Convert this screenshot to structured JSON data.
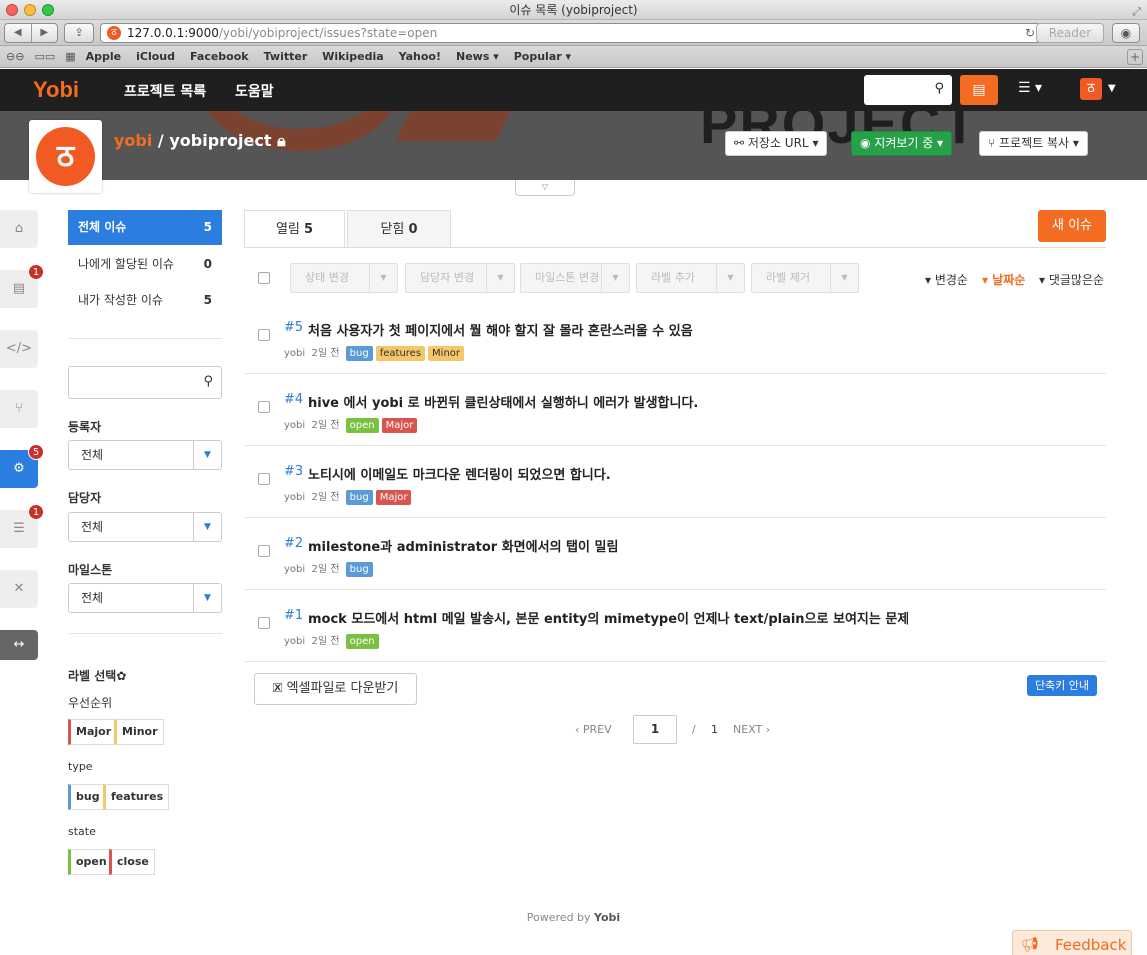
{
  "window": {
    "title": "이슈 목록 (yobiproject)"
  },
  "browser": {
    "url_host": "127.0.0.1:9000",
    "url_path": "/yobi/yobiproject/issues?state=open",
    "reader_label": "Reader",
    "bookmarks": [
      "Apple",
      "iCloud",
      "Facebook",
      "Twitter",
      "Wikipedia",
      "Yahoo!",
      "News ▾",
      "Popular ▾"
    ]
  },
  "app": {
    "logo": "Yobi",
    "nav": [
      "프로젝트 목록",
      "도움말"
    ]
  },
  "project": {
    "owner": "yobi",
    "separator": " / ",
    "name": "yobiproject",
    "repo_url_label": "저장소 URL",
    "watching_label": "지켜보기 중",
    "fork_label": "프로젝트 복사"
  },
  "rail": {
    "badges": [
      "1",
      "5",
      "1"
    ]
  },
  "sidebar": {
    "links": [
      {
        "label": "전체 이슈",
        "count": "5"
      },
      {
        "label": "나에게 할당된 이슈",
        "count": "0"
      },
      {
        "label": "내가 작성한 이슈",
        "count": "5"
      }
    ],
    "filters": [
      {
        "label": "등록자",
        "value": "전체"
      },
      {
        "label": "담당자",
        "value": "전체"
      },
      {
        "label": "마일스톤",
        "value": "전체"
      }
    ],
    "label_select_title": "라벨 선택",
    "label_groups": [
      {
        "name": "우선순위",
        "labels": [
          "Major",
          "Minor"
        ]
      },
      {
        "name": "type",
        "labels": [
          "bug",
          "features"
        ]
      },
      {
        "name": "state",
        "labels": [
          "open",
          "close"
        ]
      }
    ]
  },
  "tabs": [
    {
      "label": "열림",
      "count": "5"
    },
    {
      "label": "닫힘",
      "count": "0"
    }
  ],
  "new_issue_label": "새 이슈",
  "bulk_actions": [
    "상태 변경",
    "담당자 변경",
    "마일스톤 변경",
    "라벨 추가",
    "라벨 제거"
  ],
  "sort_options": [
    "변경순",
    "날짜순",
    "댓글많은순"
  ],
  "issues": [
    {
      "num": "#5",
      "title": "처음 사용자가 첫 페이지에서 뭘 해야 할지 잘 몰라 혼란스러울 수 있음",
      "author": "yobi",
      "time": "2일 전",
      "tags": [
        "bug",
        "features",
        "Minor"
      ]
    },
    {
      "num": "#4",
      "title": "hive 에서 yobi 로 바뀐뒤 클린상태에서 실행하니 에러가 발생합니다.",
      "author": "yobi",
      "time": "2일 전",
      "tags": [
        "open",
        "Major"
      ]
    },
    {
      "num": "#3",
      "title": "노티시에 이메일도 마크다운 렌더링이 되었으면 합니다.",
      "author": "yobi",
      "time": "2일 전",
      "tags": [
        "bug",
        "Major"
      ]
    },
    {
      "num": "#2",
      "title": "milestone과 administrator 화면에서의 탭이 밀림",
      "author": "yobi",
      "time": "2일 전",
      "tags": [
        "bug"
      ]
    },
    {
      "num": "#1",
      "title": "mock 모드에서 html 메일 발송시, 본문 entity의 mimetype이 언제나 text/plain으로 보여지는 문제 (",
      "author": "yobi",
      "time": "2일 전",
      "tags": [
        "open"
      ]
    }
  ],
  "tag_colors": {
    "bug": "#5b9bd5",
    "features": "#f5c76a",
    "Minor": "#f5c76a",
    "open": "#7ac142",
    "Major": "#d9534f"
  },
  "excel_label": "엑셀파일로 다운받기",
  "shortcut_label": "단축키 안내",
  "pagination": {
    "prev": "PREV",
    "current": "1",
    "slash": "/",
    "total": "1",
    "next": "NEXT"
  },
  "footer": {
    "powered_by": "Powered by",
    "brand": "Yobi"
  },
  "feedback_label": "Feedback"
}
